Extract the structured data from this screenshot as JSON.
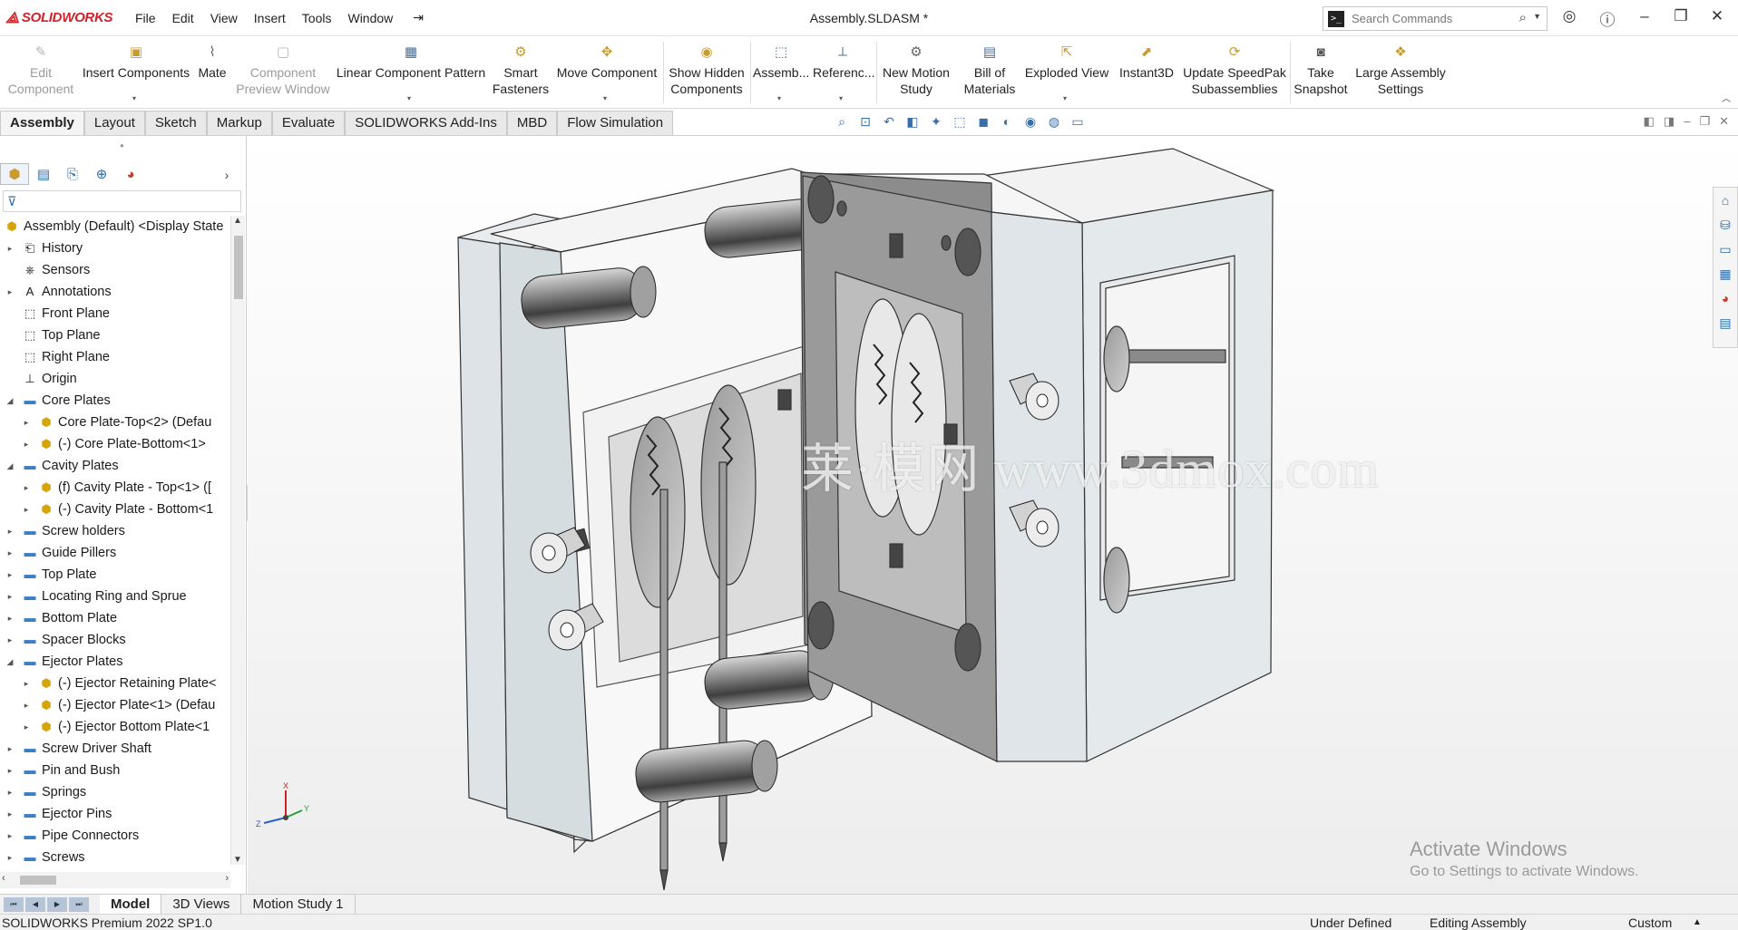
{
  "app": {
    "brand": "SOLIDWORKS",
    "document_title": "Assembly.SLDASM *",
    "menus": [
      "File",
      "Edit",
      "View",
      "Insert",
      "Tools",
      "Window"
    ]
  },
  "search": {
    "placeholder": "Search Commands"
  },
  "command_manager": {
    "tools": [
      {
        "label": "Edit\nComponent",
        "icon": "edit-component-icon",
        "enabled": false
      },
      {
        "label": "Insert Components",
        "icon": "insert-components-icon",
        "enabled": true
      },
      {
        "label": "Mate",
        "icon": "mate-paperclip-icon",
        "enabled": true
      },
      {
        "label": "Component\nPreview Window",
        "icon": "preview-window-icon",
        "enabled": false
      },
      {
        "label": "Linear Component Pattern",
        "icon": "linear-pattern-icon",
        "enabled": true
      },
      {
        "label": "Smart\nFasteners",
        "icon": "smart-fasteners-icon",
        "enabled": true
      },
      {
        "label": "Move Component",
        "icon": "move-component-icon",
        "enabled": true
      },
      {
        "label": "Show Hidden\nComponents",
        "icon": "show-hidden-icon",
        "enabled": true
      },
      {
        "label": "Assemb...",
        "icon": "assembly-features-icon",
        "enabled": true
      },
      {
        "label": "Referenc...",
        "icon": "reference-geometry-icon",
        "enabled": true
      },
      {
        "label": "New Motion\nStudy",
        "icon": "motion-study-icon",
        "enabled": true
      },
      {
        "label": "Bill of\nMaterials",
        "icon": "bom-icon",
        "enabled": true
      },
      {
        "label": "Exploded View",
        "icon": "exploded-view-icon",
        "enabled": true
      },
      {
        "label": "Instant3D",
        "icon": "instant3d-icon",
        "enabled": true
      },
      {
        "label": "Update SpeedPak\nSubassemblies",
        "icon": "speedpak-icon",
        "enabled": true
      },
      {
        "label": "Take\nSnapshot",
        "icon": "camera-icon",
        "enabled": true
      },
      {
        "label": "Large Assembly\nSettings",
        "icon": "large-assembly-icon",
        "enabled": true
      }
    ]
  },
  "tabs": [
    "Assembly",
    "Layout",
    "Sketch",
    "Markup",
    "Evaluate",
    "SOLIDWORKS Add-Ins",
    "MBD",
    "Flow Simulation"
  ],
  "active_tab": "Assembly",
  "feature_tree": {
    "root": "Assembly (Default) <Display State",
    "items": [
      {
        "label": "History",
        "icon": "history-icon",
        "kind": "special",
        "expander": true
      },
      {
        "label": "Sensors",
        "icon": "sensors-icon",
        "kind": "special",
        "expander": false
      },
      {
        "label": "Annotations",
        "icon": "annotations-icon",
        "kind": "special",
        "expander": true
      },
      {
        "label": "Front Plane",
        "icon": "plane-icon",
        "kind": "plane",
        "expander": false
      },
      {
        "label": "Top Plane",
        "icon": "plane-icon",
        "kind": "plane",
        "expander": false
      },
      {
        "label": "Right Plane",
        "icon": "plane-icon",
        "kind": "plane",
        "expander": false
      },
      {
        "label": "Origin",
        "icon": "origin-icon",
        "kind": "origin",
        "expander": false
      },
      {
        "label": "Core Plates",
        "icon": "folder-icon",
        "kind": "folder",
        "expander": true,
        "expanded": true,
        "children": [
          "Core Plate-Top<2> (Defau",
          "(-) Core Plate-Bottom<1>"
        ]
      },
      {
        "label": "Cavity Plates",
        "icon": "folder-icon",
        "kind": "folder",
        "expander": true,
        "expanded": true,
        "children": [
          "(f) Cavity Plate - Top<1> ([",
          "(-) Cavity Plate - Bottom<1"
        ]
      },
      {
        "label": "Screw holders",
        "icon": "folder-icon",
        "kind": "folder",
        "expander": true
      },
      {
        "label": "Guide Pillers",
        "icon": "folder-icon",
        "kind": "folder",
        "expander": true
      },
      {
        "label": "Top Plate",
        "icon": "folder-icon",
        "kind": "folder",
        "expander": true
      },
      {
        "label": "Locating Ring and Sprue",
        "icon": "folder-icon",
        "kind": "folder",
        "expander": true
      },
      {
        "label": "Bottom Plate",
        "icon": "folder-icon",
        "kind": "folder",
        "expander": true
      },
      {
        "label": "Spacer Blocks",
        "icon": "folder-icon",
        "kind": "folder",
        "expander": true
      },
      {
        "label": "Ejector Plates",
        "icon": "folder-icon",
        "kind": "folder",
        "expander": true,
        "expanded": true,
        "children": [
          "(-) Ejector Retaining Plate<",
          "(-) Ejector Plate<1> (Defau",
          "(-) Ejector Bottom Plate<1"
        ]
      },
      {
        "label": "Screw Driver Shaft",
        "icon": "folder-icon",
        "kind": "folder",
        "expander": true
      },
      {
        "label": "Pin and Bush",
        "icon": "folder-icon",
        "kind": "folder",
        "expander": true
      },
      {
        "label": "Springs",
        "icon": "folder-icon",
        "kind": "folder",
        "expander": true
      },
      {
        "label": "Ejector Pins",
        "icon": "folder-icon",
        "kind": "folder",
        "expander": true
      },
      {
        "label": "Pipe Connectors",
        "icon": "folder-icon",
        "kind": "folder",
        "expander": true
      },
      {
        "label": "Screws",
        "icon": "folder-icon",
        "kind": "folder",
        "expander": true
      }
    ]
  },
  "graphics": {
    "watermark": "莱·模网 www.3dmox.com",
    "triad_labels": {
      "x": "X",
      "y": "Y",
      "z": "Z"
    }
  },
  "activate_windows": {
    "line1": "Activate Windows",
    "line2": "Go to Settings to activate Windows."
  },
  "bottom_tabs": [
    "Model",
    "3D Views",
    "Motion Study 1"
  ],
  "active_bottom_tab": "Model",
  "status": {
    "product": "SOLIDWORKS Premium 2022 SP1.0",
    "state": "Under Defined",
    "mode": "Editing Assembly",
    "units": "Custom"
  },
  "colors": {
    "brand_red": "#d0202a",
    "folder_blue": "#3c7ec4",
    "part_yellow": "#d6a30a",
    "viewport_bg": "#f7f7f7"
  }
}
